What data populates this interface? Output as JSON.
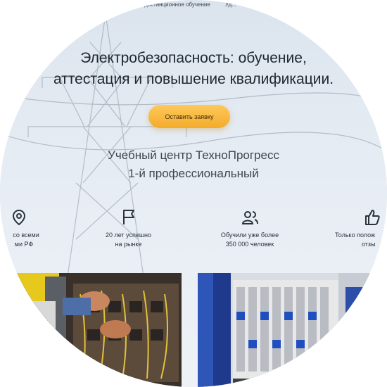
{
  "nav": {
    "item1": "дистанционное обучение",
    "item2": "Уд..."
  },
  "hero": {
    "title_line1": "Электробезопасность: обучение,",
    "title_line2": "аттестация и повышение квалификации.",
    "cta_label": "Оставить заявку",
    "subtitle_line1": "Учебный центр ТехноПрогресс",
    "subtitle_line2": "1-й профессиональный"
  },
  "features": [
    {
      "icon": "map-pin-icon",
      "line1": "со всеми",
      "line2": "ми РФ"
    },
    {
      "icon": "flag-icon",
      "line1": "20 лет успешно",
      "line2": "на рынке"
    },
    {
      "icon": "users-icon",
      "line1": "Обучили уже более",
      "line2": "350 000 человек"
    },
    {
      "icon": "thumbs-up-icon",
      "line1": "Только полож",
      "line2": "отзы"
    }
  ],
  "colors": {
    "cta": "#f6b63a",
    "text": "#1e2630",
    "background": "#e2e9f1"
  },
  "photos": [
    {
      "icon": "photo-electrician-wiring"
    },
    {
      "icon": "photo-electrical-panel"
    }
  ]
}
